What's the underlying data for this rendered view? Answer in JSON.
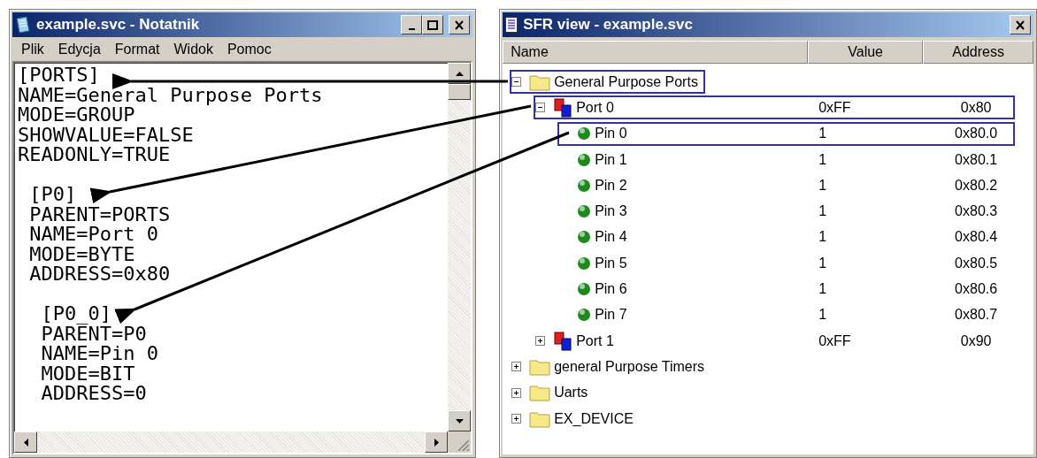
{
  "notepad": {
    "title": "example.svc - Notatnik",
    "menu": [
      "Plik",
      "Edycja",
      "Format",
      "Widok",
      "Pomoc"
    ],
    "blocks": [
      {
        "lines": [
          "[PORTS]",
          "NAME=General Purpose Ports",
          "MODE=GROUP",
          "SHOWVALUE=FALSE",
          "READONLY=TRUE"
        ]
      },
      {
        "lines": [
          " [P0]",
          " PARENT=PORTS",
          " NAME=Port 0",
          " MODE=BYTE",
          " ADDRESS=0x80"
        ]
      },
      {
        "lines": [
          "  [P0_0]",
          "  PARENT=P0",
          "  NAME=Pin 0",
          "  MODE=BIT",
          "  ADDRESS=0"
        ]
      }
    ]
  },
  "sfr_view": {
    "title": "SFR view - example.svc",
    "columns": [
      "Name",
      "Value",
      "Address"
    ],
    "tree": [
      {
        "kind": "folder",
        "name": "General Purpose Ports",
        "expanded": true,
        "outlined": true,
        "children": [
          {
            "kind": "port",
            "name": "Port 0",
            "value": "0xFF",
            "address": "0x80",
            "expanded": true,
            "outlined": true,
            "children": [
              {
                "kind": "pin",
                "name": "Pin 0",
                "value": "1",
                "address": "0x80.0",
                "outlined": true
              },
              {
                "kind": "pin",
                "name": "Pin 1",
                "value": "1",
                "address": "0x80.1",
                "outlined": false
              },
              {
                "kind": "pin",
                "name": "Pin 2",
                "value": "1",
                "address": "0x80.2",
                "outlined": false
              },
              {
                "kind": "pin",
                "name": "Pin 3",
                "value": "1",
                "address": "0x80.3",
                "outlined": false
              },
              {
                "kind": "pin",
                "name": "Pin 4",
                "value": "1",
                "address": "0x80.4",
                "outlined": false
              },
              {
                "kind": "pin",
                "name": "Pin 5",
                "value": "1",
                "address": "0x80.5",
                "outlined": false
              },
              {
                "kind": "pin",
                "name": "Pin 6",
                "value": "1",
                "address": "0x80.6",
                "outlined": false
              },
              {
                "kind": "pin",
                "name": "Pin 7",
                "value": "1",
                "address": "0x80.7",
                "outlined": false
              }
            ]
          },
          {
            "kind": "port",
            "name": "Port 1",
            "value": "0xFF",
            "address": "0x90",
            "expanded": false,
            "outlined": false
          }
        ]
      },
      {
        "kind": "folder",
        "name": "general Purpose Timers",
        "expanded": false,
        "outlined": false
      },
      {
        "kind": "folder",
        "name": "Uarts",
        "expanded": false,
        "outlined": false
      },
      {
        "kind": "folder",
        "name": "EX_DEVICE",
        "expanded": false,
        "outlined": false
      }
    ]
  }
}
